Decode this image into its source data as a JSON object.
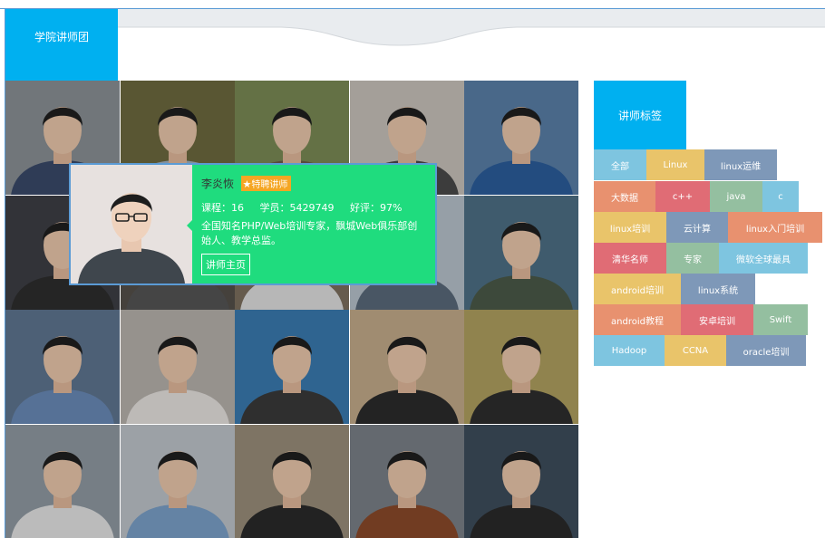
{
  "header": {
    "tab_label": "学院讲师团"
  },
  "popup": {
    "name": "李炎恢",
    "badge": "特聘讲师",
    "courses": "课程：16",
    "students": "学员：5429749",
    "rating": "好评：97%",
    "description": "全国知名PHP/Web培训专家，飘城Web俱乐部创始人、教学总监。",
    "home_button": "讲师主页"
  },
  "tags_panel": {
    "title": "讲师标签",
    "tags": [
      {
        "label": "全部",
        "color": "#7ec5e0"
      },
      {
        "label": "Linux",
        "color": "#e9c46a"
      },
      {
        "label": "linux运维",
        "color": "#7e98b8"
      },
      {
        "label": "大数据",
        "color": "#e8916f"
      },
      {
        "label": "c++",
        "color": "#e06c75"
      },
      {
        "label": "java",
        "color": "#94bfa0"
      },
      {
        "label": "c",
        "color": "#7ec5e0"
      },
      {
        "label": "linux培训",
        "color": "#e9c46a"
      },
      {
        "label": "云计算",
        "color": "#7e98b8"
      },
      {
        "label": "linux入门培训",
        "color": "#e8916f"
      },
      {
        "label": "清华名师",
        "color": "#e06c75"
      },
      {
        "label": "专家",
        "color": "#94bfa0"
      },
      {
        "label": "微软全球最具",
        "color": "#7ec5e0"
      },
      {
        "label": "android培训",
        "color": "#e9c46a"
      },
      {
        "label": "linux系统",
        "color": "#7e98b8"
      },
      {
        "label": "android教程",
        "color": "#e8916f"
      },
      {
        "label": "安卓培训",
        "color": "#e06c75"
      },
      {
        "label": "Swift",
        "color": "#94bfa0"
      },
      {
        "label": "Hadoop",
        "color": "#7ec5e0"
      },
      {
        "label": "CCNA",
        "color": "#e9c46a"
      },
      {
        "label": "oracle培训",
        "color": "#7e98b8"
      }
    ]
  },
  "colors": {
    "accent": "#00b0f0",
    "popup_bg": "#1fdc7e",
    "badge": "#f5a623"
  }
}
